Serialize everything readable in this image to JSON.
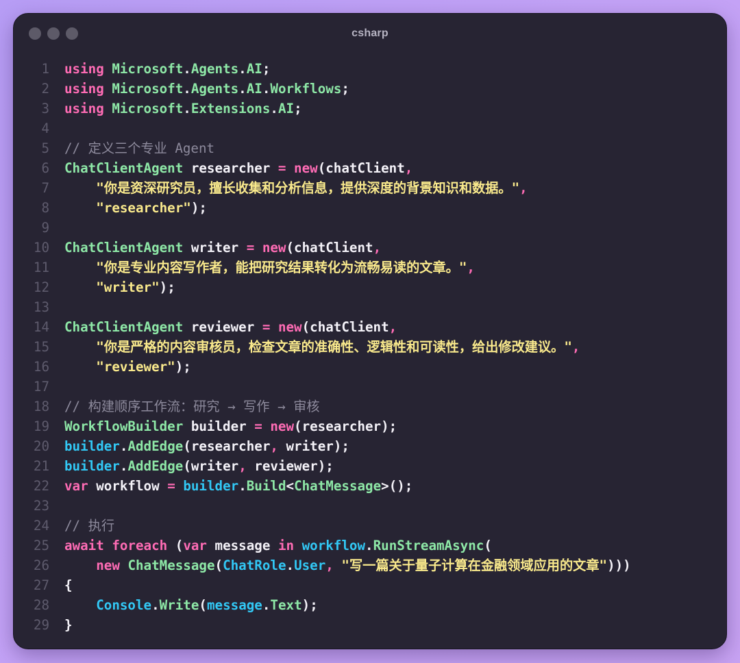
{
  "window": {
    "title": "csharp"
  },
  "code": {
    "language": "csharp",
    "lines": [
      {
        "n": "1",
        "tokens": [
          [
            "kw",
            "using"
          ],
          [
            "punc",
            " "
          ],
          [
            "type",
            "Microsoft"
          ],
          [
            "punc",
            "."
          ],
          [
            "type",
            "Agents"
          ],
          [
            "punc",
            "."
          ],
          [
            "type",
            "AI"
          ],
          [
            "punc",
            ";"
          ]
        ]
      },
      {
        "n": "2",
        "tokens": [
          [
            "kw",
            "using"
          ],
          [
            "punc",
            " "
          ],
          [
            "type",
            "Microsoft"
          ],
          [
            "punc",
            "."
          ],
          [
            "type",
            "Agents"
          ],
          [
            "punc",
            "."
          ],
          [
            "type",
            "AI"
          ],
          [
            "punc",
            "."
          ],
          [
            "type",
            "Workflows"
          ],
          [
            "punc",
            ";"
          ]
        ]
      },
      {
        "n": "3",
        "tokens": [
          [
            "kw",
            "using"
          ],
          [
            "punc",
            " "
          ],
          [
            "type",
            "Microsoft"
          ],
          [
            "punc",
            "."
          ],
          [
            "type",
            "Extensions"
          ],
          [
            "punc",
            "."
          ],
          [
            "type",
            "AI"
          ],
          [
            "punc",
            ";"
          ]
        ]
      },
      {
        "n": "4",
        "tokens": []
      },
      {
        "n": "5",
        "tokens": [
          [
            "cmt",
            "// 定义三个专业 Agent"
          ]
        ]
      },
      {
        "n": "6",
        "tokens": [
          [
            "type",
            "ChatClientAgent"
          ],
          [
            "var",
            " researcher "
          ],
          [
            "kw",
            "="
          ],
          [
            "punc",
            " "
          ],
          [
            "kw",
            "new"
          ],
          [
            "punc",
            "(chatClient"
          ],
          [
            "comma",
            ","
          ]
        ]
      },
      {
        "n": "7",
        "tokens": [
          [
            "punc",
            "    "
          ],
          [
            "str",
            "\"你是资深研究员，擅长收集和分析信息，提供深度的背景知识和数据。\""
          ],
          [
            "comma",
            ","
          ]
        ]
      },
      {
        "n": "8",
        "tokens": [
          [
            "punc",
            "    "
          ],
          [
            "str",
            "\"researcher\""
          ],
          [
            "punc",
            ");"
          ]
        ]
      },
      {
        "n": "9",
        "tokens": []
      },
      {
        "n": "10",
        "tokens": [
          [
            "type",
            "ChatClientAgent"
          ],
          [
            "var",
            " writer "
          ],
          [
            "kw",
            "="
          ],
          [
            "punc",
            " "
          ],
          [
            "kw",
            "new"
          ],
          [
            "punc",
            "(chatClient"
          ],
          [
            "comma",
            ","
          ]
        ]
      },
      {
        "n": "11",
        "tokens": [
          [
            "punc",
            "    "
          ],
          [
            "str",
            "\"你是专业内容写作者，能把研究结果转化为流畅易读的文章。\""
          ],
          [
            "comma",
            ","
          ]
        ]
      },
      {
        "n": "12",
        "tokens": [
          [
            "punc",
            "    "
          ],
          [
            "str",
            "\"writer\""
          ],
          [
            "punc",
            ");"
          ]
        ]
      },
      {
        "n": "13",
        "tokens": []
      },
      {
        "n": "14",
        "tokens": [
          [
            "type",
            "ChatClientAgent"
          ],
          [
            "var",
            " reviewer "
          ],
          [
            "kw",
            "="
          ],
          [
            "punc",
            " "
          ],
          [
            "kw",
            "new"
          ],
          [
            "punc",
            "(chatClient"
          ],
          [
            "comma",
            ","
          ]
        ]
      },
      {
        "n": "15",
        "tokens": [
          [
            "punc",
            "    "
          ],
          [
            "str",
            "\"你是严格的内容审核员，检查文章的准确性、逻辑性和可读性，给出修改建议。\""
          ],
          [
            "comma",
            ","
          ]
        ]
      },
      {
        "n": "16",
        "tokens": [
          [
            "punc",
            "    "
          ],
          [
            "str",
            "\"reviewer\""
          ],
          [
            "punc",
            ");"
          ]
        ]
      },
      {
        "n": "17",
        "tokens": []
      },
      {
        "n": "18",
        "tokens": [
          [
            "cmt",
            "// 构建顺序工作流：研究 → 写作 → 审核"
          ]
        ]
      },
      {
        "n": "19",
        "tokens": [
          [
            "type",
            "WorkflowBuilder"
          ],
          [
            "var",
            " builder "
          ],
          [
            "kw",
            "="
          ],
          [
            "punc",
            " "
          ],
          [
            "kw",
            "new"
          ],
          [
            "punc",
            "(researcher);"
          ]
        ]
      },
      {
        "n": "20",
        "tokens": [
          [
            "fn",
            "builder"
          ],
          [
            "punc",
            "."
          ],
          [
            "type",
            "AddEdge"
          ],
          [
            "punc",
            "(researcher"
          ],
          [
            "comma",
            ","
          ],
          [
            "punc",
            " writer);"
          ]
        ]
      },
      {
        "n": "21",
        "tokens": [
          [
            "fn",
            "builder"
          ],
          [
            "punc",
            "."
          ],
          [
            "type",
            "AddEdge"
          ],
          [
            "punc",
            "(writer"
          ],
          [
            "comma",
            ","
          ],
          [
            "punc",
            " reviewer);"
          ]
        ]
      },
      {
        "n": "22",
        "tokens": [
          [
            "kw",
            "var"
          ],
          [
            "var",
            " workflow "
          ],
          [
            "kw",
            "="
          ],
          [
            "punc",
            " "
          ],
          [
            "fn",
            "builder"
          ],
          [
            "punc",
            "."
          ],
          [
            "type",
            "Build"
          ],
          [
            "punc",
            "<"
          ],
          [
            "type",
            "ChatMessage"
          ],
          [
            "punc",
            ">();"
          ]
        ]
      },
      {
        "n": "23",
        "tokens": []
      },
      {
        "n": "24",
        "tokens": [
          [
            "cmt",
            "// 执行"
          ]
        ]
      },
      {
        "n": "25",
        "tokens": [
          [
            "kw",
            "await"
          ],
          [
            "punc",
            " "
          ],
          [
            "kw",
            "foreach"
          ],
          [
            "punc",
            " ("
          ],
          [
            "kw",
            "var"
          ],
          [
            "var",
            " message "
          ],
          [
            "kw",
            "in"
          ],
          [
            "punc",
            " "
          ],
          [
            "fn",
            "workflow"
          ],
          [
            "punc",
            "."
          ],
          [
            "type",
            "RunStreamAsync"
          ],
          [
            "punc",
            "("
          ]
        ]
      },
      {
        "n": "26",
        "tokens": [
          [
            "punc",
            "    "
          ],
          [
            "kw",
            "new"
          ],
          [
            "punc",
            " "
          ],
          [
            "type",
            "ChatMessage"
          ],
          [
            "punc",
            "("
          ],
          [
            "fn",
            "ChatRole"
          ],
          [
            "punc",
            "."
          ],
          [
            "fn",
            "User"
          ],
          [
            "comma",
            ","
          ],
          [
            "punc",
            " "
          ],
          [
            "str",
            "\"写一篇关于量子计算在金融领域应用的文章\""
          ],
          [
            "punc",
            ")))"
          ]
        ]
      },
      {
        "n": "27",
        "tokens": [
          [
            "punc",
            "{"
          ]
        ]
      },
      {
        "n": "28",
        "tokens": [
          [
            "punc",
            "    "
          ],
          [
            "fn",
            "Console"
          ],
          [
            "punc",
            "."
          ],
          [
            "type",
            "Write"
          ],
          [
            "punc",
            "("
          ],
          [
            "fn",
            "message"
          ],
          [
            "punc",
            "."
          ],
          [
            "type",
            "Text"
          ],
          [
            "punc",
            ");"
          ]
        ]
      },
      {
        "n": "29",
        "tokens": [
          [
            "punc",
            "}"
          ]
        ]
      }
    ]
  },
  "colors": {
    "background_gradient": [
      "#b79df5",
      "#c8a3f3"
    ],
    "window": "#272433",
    "keyword": "#ff6cb5",
    "type": "#8ee8a7",
    "identifier": "#32c8f5",
    "string": "#f9e98c",
    "comment": "#8d8a9c",
    "line_number": "#5e5b6d",
    "text": "#f4f2f8"
  }
}
